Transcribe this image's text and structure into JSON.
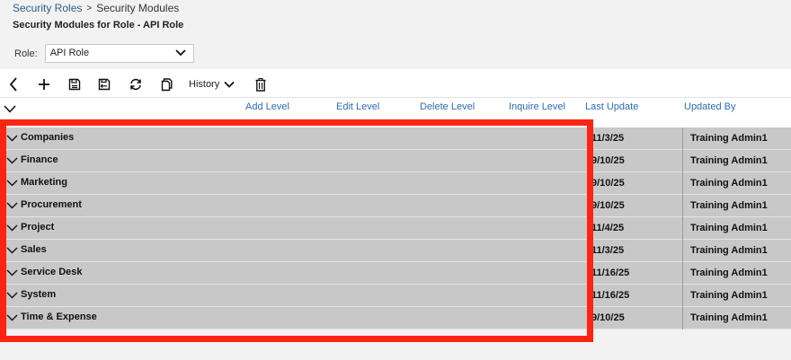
{
  "breadcrumb": {
    "parent": "Security Roles",
    "separator": ">",
    "current": "Security Modules"
  },
  "page_title": "Security Modules for Role - API Role",
  "role": {
    "label": "Role:",
    "selected": "API Role"
  },
  "toolbar": {
    "history_label": "History",
    "icons": [
      "back-icon",
      "add-icon",
      "save-icon",
      "save-and-exit-icon",
      "refresh-icon",
      "copy-icon",
      "chevron-down-icon",
      "trash-icon"
    ]
  },
  "columns": {
    "add_level": "Add Level",
    "edit_level": "Edit Level",
    "delete_level": "Delete Level",
    "inquire_level": "Inquire Level",
    "last_update": "Last Update",
    "updated_by": "Updated By"
  },
  "modules": [
    {
      "name": "Companies",
      "last_update": "11/3/25",
      "updated_by": "Training Admin1"
    },
    {
      "name": "Finance",
      "last_update": "9/10/25",
      "updated_by": "Training Admin1"
    },
    {
      "name": "Marketing",
      "last_update": "9/10/25",
      "updated_by": "Training Admin1"
    },
    {
      "name": "Procurement",
      "last_update": "9/10/25",
      "updated_by": "Training Admin1"
    },
    {
      "name": "Project",
      "last_update": "11/4/25",
      "updated_by": "Training Admin1"
    },
    {
      "name": "Sales",
      "last_update": "11/3/25",
      "updated_by": "Training Admin1"
    },
    {
      "name": "Service Desk",
      "last_update": "11/16/25",
      "updated_by": "Training Admin1"
    },
    {
      "name": "System",
      "last_update": "11/16/25",
      "updated_by": "Training Admin1"
    },
    {
      "name": "Time & Expense",
      "last_update": "9/10/25",
      "updated_by": "Training Admin1"
    }
  ],
  "colors": {
    "highlight": "#ff2412",
    "link": "#2e6cb0",
    "row_bg": "#c8c8c8"
  }
}
